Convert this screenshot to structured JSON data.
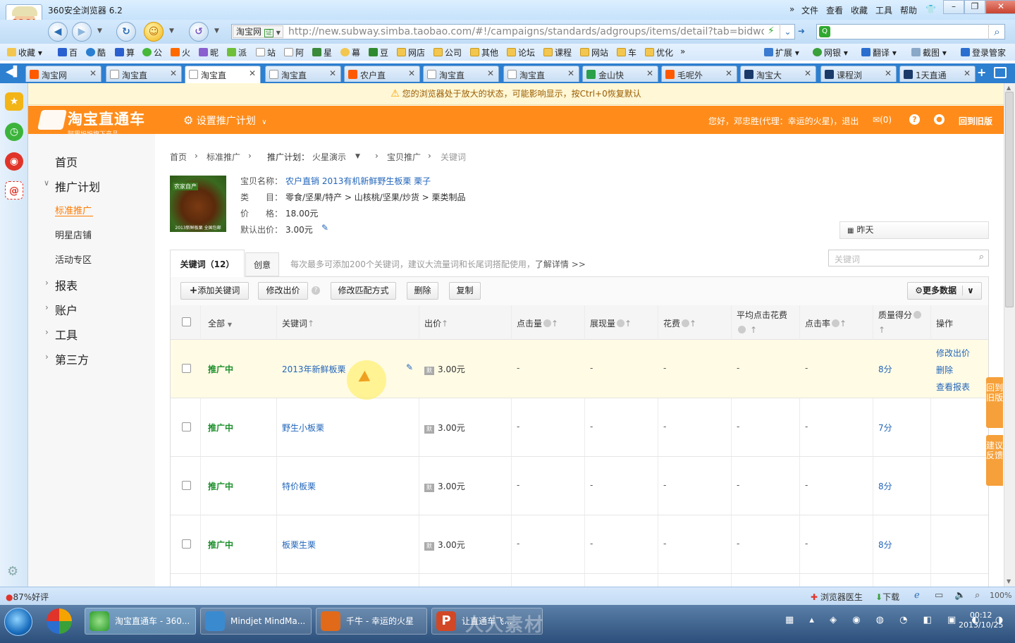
{
  "browser": {
    "title": "360安全浏览器 6.2",
    "avatar_text": "COOL",
    "menu": [
      "文件",
      "查看",
      "收藏",
      "工具",
      "帮助"
    ],
    "address_badge": "淘宝网",
    "address_badge_tag": "证",
    "url": "http://new.subway.simba.taobao.com/#!/campaigns/standards/adgroups/items/detail?tab=bidword&",
    "bookmarks": [
      "收藏",
      "百",
      "酷",
      "算",
      "公",
      "火",
      "昵",
      "派",
      "站",
      "阿",
      "星",
      "幕",
      "豆",
      "网店",
      "公司",
      "其他",
      "论坛",
      "课程",
      "网站",
      "车",
      "优化"
    ],
    "bookmark_right": [
      "扩展",
      "网银",
      "翻译",
      "截图",
      "登录管家"
    ],
    "tabs": [
      {
        "label": "淘宝网",
        "icon": "taobao-icon"
      },
      {
        "label": "淘宝直",
        "icon": "page-icon"
      },
      {
        "label": "淘宝直",
        "icon": "page-icon",
        "active": true
      },
      {
        "label": "淘宝直",
        "icon": "page-icon"
      },
      {
        "label": "农户直",
        "icon": "taobao-icon"
      },
      {
        "label": "淘宝直",
        "icon": "page-icon"
      },
      {
        "label": "淘宝直",
        "icon": "page-icon"
      },
      {
        "label": "金山快",
        "icon": "kingsoft-icon"
      },
      {
        "label": "毛呢外",
        "icon": "taobao-icon"
      },
      {
        "label": "淘宝大",
        "icon": "xue-icon"
      },
      {
        "label": "课程浏",
        "icon": "xue-icon"
      },
      {
        "label": "1天直通",
        "icon": "xue-icon"
      }
    ],
    "zoom_notice": "您的浏览器处于放大的状态，可能影响显示，按Ctrl+0恢复默认",
    "status": {
      "rating": "87%好评",
      "doctor": "浏览器医生",
      "download": "下载",
      "zoom": "100%"
    }
  },
  "header": {
    "logo_main": "淘宝直通车",
    "logo_sub": "阿里妈妈旗下产品",
    "plan_menu": "设置推广计划",
    "user": "您好，邓忠胜(代理：幸运的火星)，退出",
    "mail": "(0)",
    "old_version": "回到旧版"
  },
  "leftnav": {
    "home": "首页",
    "plans": "推广计划",
    "standard": "标准推广",
    "star_shop": "明星店铺",
    "activity": "活动专区",
    "report": "报表",
    "account": "账户",
    "tools": "工具",
    "third": "第三方"
  },
  "breadcrumb": {
    "home": "首页",
    "standard": "标准推广",
    "plan_label": "推广计划：",
    "plan_name": "火星演示",
    "item": "宝贝推广",
    "current": "关键词"
  },
  "product": {
    "name_label": "宝贝名称：",
    "name": "农户直销 2013有机新鲜野生板栗 栗子",
    "category_label": "类　　目：",
    "category": "零食/坚果/特产 > 山核桃/坚果/炒货 > 栗类制品",
    "price_label": "价　　格：",
    "price": "18.00元",
    "default_bid_label": "默认出价：",
    "default_bid": "3.00元",
    "date_filter": "昨天",
    "image_text_top": "农家自产",
    "image_text_bottom": "2013新鲜板栗 全国包邮"
  },
  "tabs": {
    "keywords": "关键词（12）",
    "ideas": "创意",
    "hint": "每次最多可添加200个关键词，建议大流量词和长尾词搭配使用，",
    "hint_link": "了解详情 >>",
    "search_placeholder": "关键词"
  },
  "toolbar": {
    "add": "添加关键词",
    "modify_bid": "修改出价",
    "modify_match": "修改匹配方式",
    "delete": "删除",
    "copy": "复制",
    "more_data": "更多数据"
  },
  "table": {
    "headers": {
      "all": "全部",
      "keyword": "关键词",
      "bid": "出价",
      "clicks": "点击量",
      "impressions": "展现量",
      "cost": "花费",
      "avg_cpc": "平均点击花费",
      "ctr": "点击率",
      "quality": "质量得分",
      "ops": "操作"
    },
    "rows": [
      {
        "status": "推广中",
        "keyword": "2013年新鲜板栗",
        "bid": "3.00元",
        "clicks": "-",
        "impressions": "-",
        "cost": "-",
        "avg_cpc": "-",
        "ctr": "-",
        "quality": "8分"
      },
      {
        "status": "推广中",
        "keyword": "野生小板栗",
        "bid": "3.00元",
        "clicks": "-",
        "impressions": "-",
        "cost": "-",
        "avg_cpc": "-",
        "ctr": "-",
        "quality": "7分"
      },
      {
        "status": "推广中",
        "keyword": "特价板栗",
        "bid": "3.00元",
        "clicks": "-",
        "impressions": "-",
        "cost": "-",
        "avg_cpc": "-",
        "ctr": "-",
        "quality": "8分"
      },
      {
        "status": "推广中",
        "keyword": "板栗生栗",
        "bid": "3.00元",
        "clicks": "-",
        "impressions": "-",
        "cost": "-",
        "avg_cpc": "-",
        "ctr": "-",
        "quality": "8分"
      }
    ],
    "row_ops": [
      "修改出价",
      "删除",
      "查看报表"
    ],
    "bid_badge": "默"
  },
  "float_buttons": {
    "old": "回到旧版",
    "feedback": "建议反馈"
  },
  "taskbar": {
    "tasks": [
      "淘宝直通车 - 360...",
      "Mindjet MindMa...",
      "千牛 - 幸运的火星",
      "让直通车飞...",
      "人人素材"
    ],
    "time": "00:12",
    "date": "2013/10/25"
  }
}
